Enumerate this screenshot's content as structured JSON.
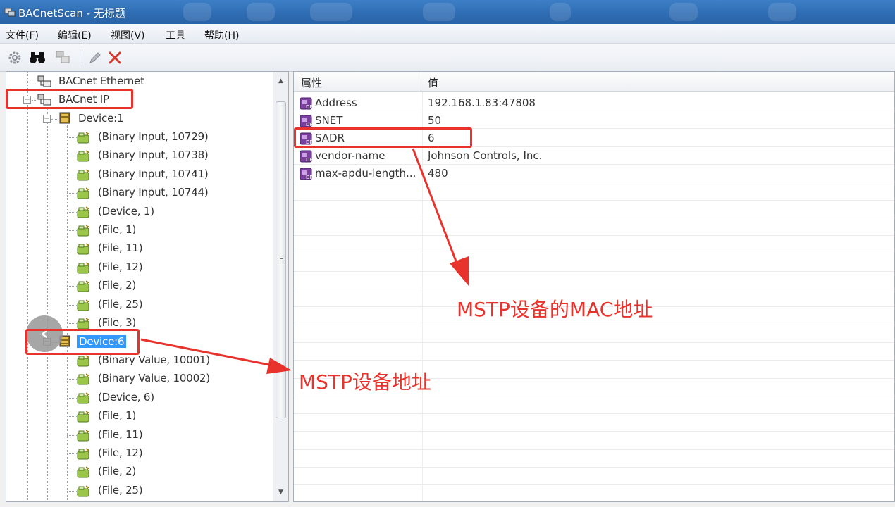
{
  "window": {
    "title": "BACnetScan - 无标题"
  },
  "menu": [
    "文件(F)",
    "编辑(E)",
    "视图(V)",
    "工具",
    "帮助(H)"
  ],
  "toolbar": {
    "icons": [
      "gear-icon",
      "binoculars-icon",
      "network-icon",
      "pencil-icon",
      "delete-icon"
    ],
    "delete_color": "#d23a2f"
  },
  "tree": {
    "ethernet": "BACnet Ethernet",
    "ip": "BACnet IP",
    "device1": {
      "label": "Device:1",
      "children": [
        "(Binary Input, 10729)",
        "(Binary Input, 10738)",
        "(Binary Input, 10741)",
        "(Binary Input, 10744)",
        "(Device, 1)",
        "(File, 1)",
        "(File, 11)",
        "(File, 12)",
        "(File, 2)",
        "(File, 25)",
        "(File, 3)"
      ]
    },
    "device6": {
      "label": "Device:6",
      "children": [
        "(Binary Value, 10001)",
        "(Binary Value, 10002)",
        "(Device, 6)",
        "(File, 1)",
        "(File, 11)",
        "(File, 12)",
        "(File, 2)",
        "(File, 25)"
      ]
    }
  },
  "properties": {
    "header_name": "属性",
    "header_value": "值",
    "rows": [
      {
        "name": "Address",
        "value": "192.168.1.83:47808"
      },
      {
        "name": "SNET",
        "value": "50"
      },
      {
        "name": "SADR",
        "value": "6"
      },
      {
        "name": "vendor-name",
        "value": "Johnson Controls, Inc."
      },
      {
        "name": "max-apdu-length...",
        "value": "480"
      }
    ]
  },
  "annotations": {
    "mac_label": "MSTP设备的MAC地址",
    "addr_label": "MSTP设备地址",
    "color": "#e8322c"
  }
}
